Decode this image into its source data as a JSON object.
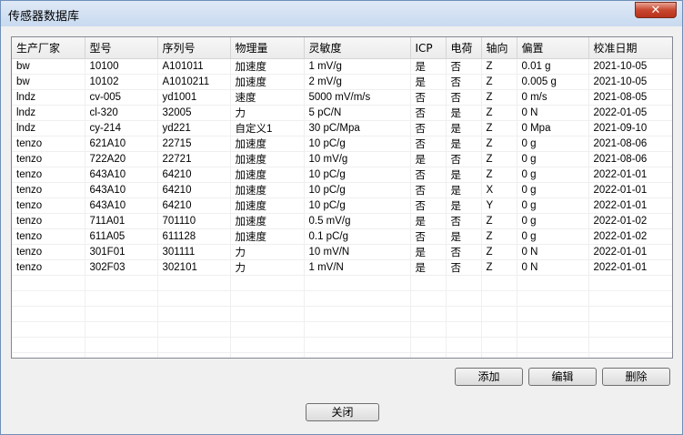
{
  "window": {
    "title": "传感器数据库",
    "close_glyph": "✕"
  },
  "table": {
    "columns": [
      "生产厂家",
      "型号",
      "序列号",
      "物理量",
      "灵敏度",
      "ICP",
      "电荷",
      "轴向",
      "偏置",
      "校准日期"
    ],
    "rows": [
      [
        "bw",
        "10100",
        "A101011",
        "加速度",
        "1 mV/g",
        "是",
        "否",
        "Z",
        "0.01 g",
        "2021-10-05"
      ],
      [
        "bw",
        "10102",
        "A1010211",
        "加速度",
        "2 mV/g",
        "是",
        "否",
        "Z",
        "0.005 g",
        "2021-10-05"
      ],
      [
        "lndz",
        "cv-005",
        "yd1001",
        "速度",
        "5000 mV/m/s",
        "否",
        "否",
        "Z",
        "0 m/s",
        "2021-08-05"
      ],
      [
        "lndz",
        "cl-320",
        "32005",
        "力",
        "5 pC/N",
        "否",
        "是",
        "Z",
        "0 N",
        "2022-01-05"
      ],
      [
        "lndz",
        "cy-214",
        "yd221",
        "自定义1",
        "30 pC/Mpa",
        "否",
        "是",
        "Z",
        "0 Mpa",
        "2021-09-10"
      ],
      [
        "tenzo",
        "621A10",
        "22715",
        "加速度",
        "10 pC/g",
        "否",
        "是",
        "Z",
        "0 g",
        "2021-08-06"
      ],
      [
        "tenzo",
        "722A20",
        "22721",
        "加速度",
        "10 mV/g",
        "是",
        "否",
        "Z",
        "0 g",
        "2021-08-06"
      ],
      [
        "tenzo",
        "643A10",
        "64210",
        "加速度",
        "10 pC/g",
        "否",
        "是",
        "Z",
        "0 g",
        "2022-01-01"
      ],
      [
        "tenzo",
        "643A10",
        "64210",
        "加速度",
        "10 pC/g",
        "否",
        "是",
        "X",
        "0 g",
        "2022-01-01"
      ],
      [
        "tenzo",
        "643A10",
        "64210",
        "加速度",
        "10 pC/g",
        "否",
        "是",
        "Y",
        "0 g",
        "2022-01-01"
      ],
      [
        "tenzo",
        "711A01",
        "701110",
        "加速度",
        "0.5 mV/g",
        "是",
        "否",
        "Z",
        "0 g",
        "2022-01-02"
      ],
      [
        "tenzo",
        "611A05",
        "611128",
        "加速度",
        "0.1 pC/g",
        "否",
        "是",
        "Z",
        "0 g",
        "2022-01-02"
      ],
      [
        "tenzo",
        "301F01",
        "301111",
        "力",
        "10 mV/N",
        "是",
        "否",
        "Z",
        "0 N",
        "2022-01-01"
      ],
      [
        "tenzo",
        "302F03",
        "302101",
        "力",
        "1 mV/N",
        "是",
        "否",
        "Z",
        "0 N",
        "2022-01-01"
      ]
    ]
  },
  "buttons": {
    "add": "添加",
    "edit": "编辑",
    "delete": "删除",
    "close": "关闭"
  }
}
